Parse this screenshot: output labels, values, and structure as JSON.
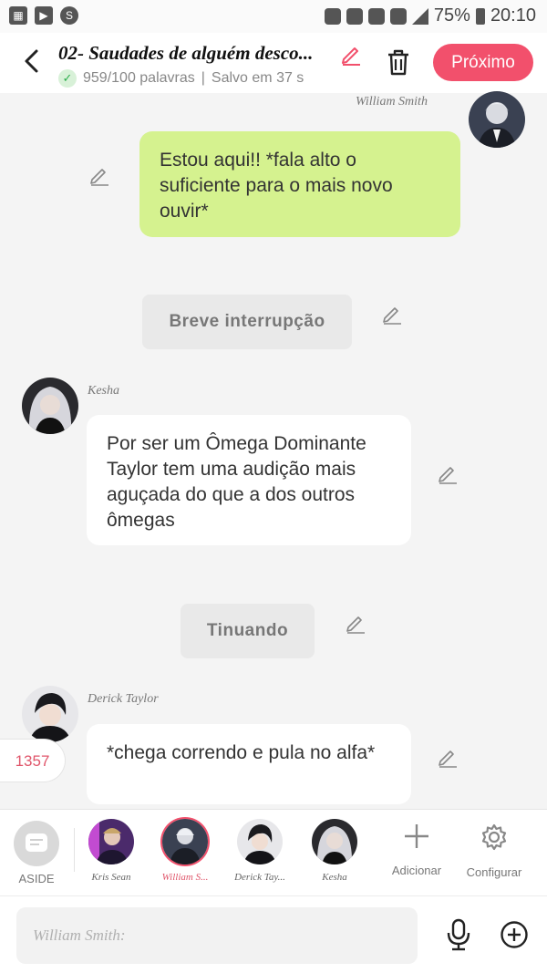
{
  "status_bar": {
    "battery_percent": "75%",
    "time": "20:10"
  },
  "header": {
    "title": "02- Saudades de alguém desco...",
    "word_count": "959/100 palavras",
    "saved": "Salvo em 37 s",
    "next_label": "Próximo"
  },
  "messages": [
    {
      "type": "speech",
      "speaker": "William Smith",
      "text": "Estou aqui!! *fala alto o suficiente para o mais novo ouvir*"
    },
    {
      "type": "aside",
      "text": "Breve interrupção"
    },
    {
      "type": "speech",
      "speaker": "Kesha",
      "text": "Por ser um Ômega Dominante Taylor tem uma audição mais aguçada do que a dos outros ômegas"
    },
    {
      "type": "aside",
      "text": "Tinuando"
    },
    {
      "type": "speech",
      "speaker": "Derick Taylor",
      "text": "*chega correndo e pula no alfa*"
    }
  ],
  "word_badge": "1357",
  "character_bar": {
    "aside_label": "ASIDE",
    "characters": [
      {
        "name": "Kris Sean",
        "active": false
      },
      {
        "name": "William S...",
        "active": true
      },
      {
        "name": "Derick Tay...",
        "active": false
      },
      {
        "name": "Kesha",
        "active": false
      }
    ],
    "add_label": "Adicionar",
    "settings_label": "Configurar"
  },
  "input": {
    "placeholder": "William Smith:"
  },
  "colors": {
    "accent": "#f2506c",
    "green_bubble": "#d5f28f",
    "check_green": "#2fae4e"
  }
}
